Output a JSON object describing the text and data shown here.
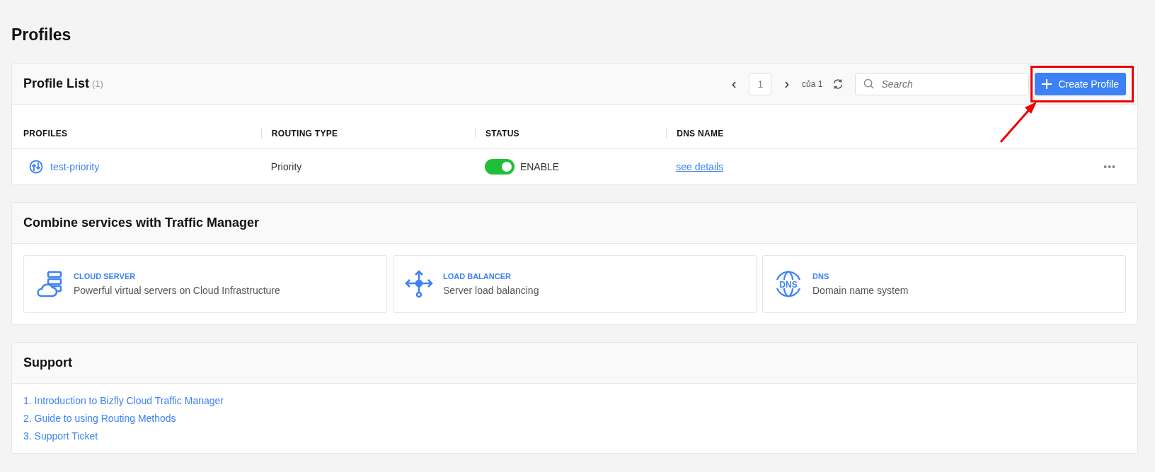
{
  "page_title": "Profiles",
  "profile_list": {
    "title": "Profile List",
    "count": "(1)",
    "pager": {
      "prev": "‹",
      "page": "1",
      "next": "›",
      "of": "của 1"
    },
    "search": {
      "placeholder": "Search"
    },
    "create_button": {
      "label": "Create Profile",
      "highlighted": true
    },
    "columns": [
      "PROFILES",
      "ROUTING TYPE",
      "STATUS",
      "DNS NAME"
    ],
    "rows": [
      {
        "name": "test-priority",
        "routing_type": "Priority",
        "enabled": true,
        "status": "ENABLE",
        "dns_link": "see details",
        "menu": "•••"
      }
    ]
  },
  "services": {
    "title": "Combine services with Traffic Manager",
    "items": [
      {
        "kind": "cloud",
        "name": "CLOUD SERVER",
        "description": "Powerful virtual servers on Cloud Infrastructure"
      },
      {
        "kind": "balancer",
        "name": "LOAD BALANCER",
        "description": "Server load balancing"
      },
      {
        "kind": "dns",
        "name": "DNS",
        "description": "Domain name system",
        "icon_label": "DNS"
      }
    ]
  },
  "support": {
    "title": "Support",
    "links": [
      "1. Introduction to Bizfly Cloud Traffic Manager",
      "2. Guide to using Routing Methods",
      "3. Support Ticket"
    ]
  }
}
